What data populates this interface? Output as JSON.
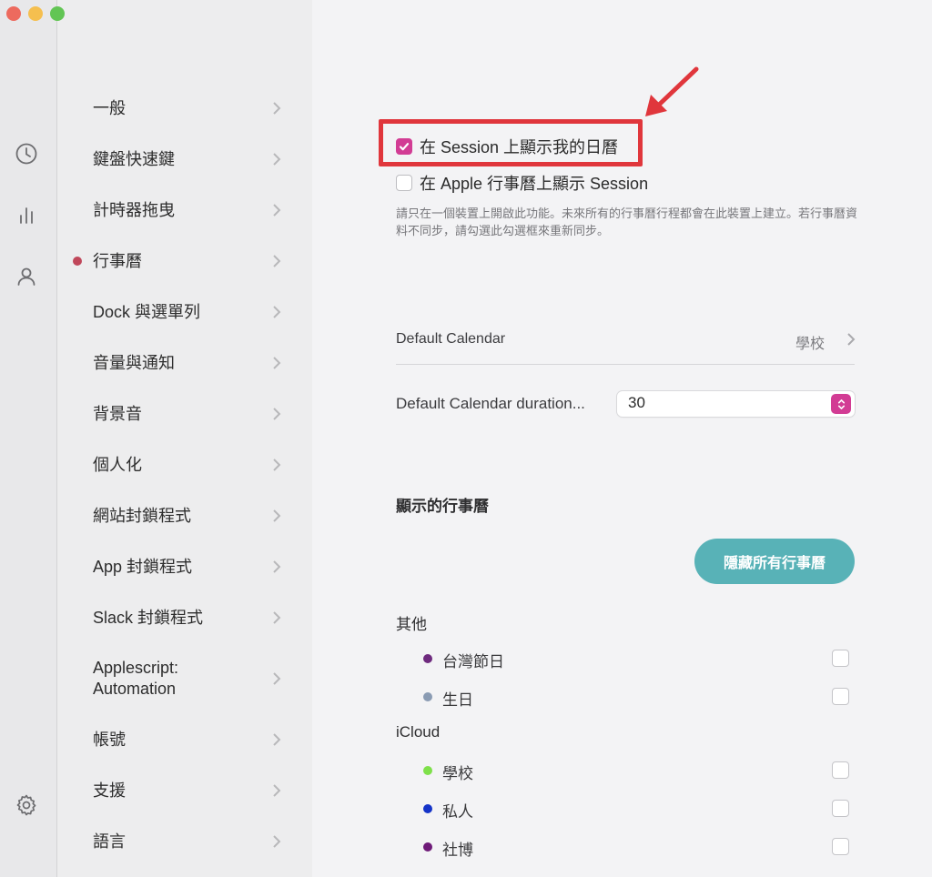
{
  "sidebar": {
    "items": [
      {
        "label": "一般",
        "active": false
      },
      {
        "label": "鍵盤快速鍵",
        "active": false
      },
      {
        "label": "計時器拖曳",
        "active": false
      },
      {
        "label": "行事曆",
        "active": true
      },
      {
        "label": "Dock 與選單列",
        "active": false
      },
      {
        "label": "音量與通知",
        "active": false
      },
      {
        "label": "背景音",
        "active": false
      },
      {
        "label": "個人化",
        "active": false
      },
      {
        "label": "網站封鎖程式",
        "active": false
      },
      {
        "label": "App 封鎖程式",
        "active": false
      },
      {
        "label": "Slack 封鎖程式",
        "active": false
      },
      {
        "label": "Applescript:\nAutomation",
        "active": false
      },
      {
        "label": "帳號",
        "active": false
      },
      {
        "label": "支援",
        "active": false
      },
      {
        "label": "語言",
        "active": false
      }
    ]
  },
  "rail_icons": [
    "clock-icon",
    "bar-chart-icon",
    "person-icon",
    "gear-icon"
  ],
  "main": {
    "show_calendar_in_session": {
      "label": "在 Session 上顯示我的日曆",
      "checked": true
    },
    "show_session_in_apple_calendar": {
      "label": "在 Apple 行事曆上顯示 Session",
      "checked": false
    },
    "help_text": "請只在一個裝置上開啟此功能。未來所有的行事曆行程都會在此裝置上建立。若行事曆資料不同步，請勾選此勾選框來重新同步。",
    "default_calendar": {
      "label": "Default Calendar",
      "value": "學校"
    },
    "default_duration": {
      "label": "Default Calendar duration...",
      "value": "30"
    },
    "shown_calendars_title": "顯示的行事曆",
    "hide_all_button": "隱藏所有行事曆",
    "groups": [
      {
        "name": "其他",
        "calendars": [
          {
            "name": "台灣節日",
            "color": "#6e2a7e",
            "checked": false
          },
          {
            "name": "生日",
            "color": "#8a9bb3",
            "checked": false
          }
        ]
      },
      {
        "name": "iCloud",
        "calendars": [
          {
            "name": "學校",
            "color": "#7ee04a",
            "checked": false
          },
          {
            "name": "私人",
            "color": "#1433c8",
            "checked": false
          },
          {
            "name": "社博",
            "color": "#6e1a78",
            "checked": false
          }
        ]
      }
    ]
  },
  "colors": {
    "accent": "#d23c94",
    "button": "#58b2b7",
    "highlight": "#e0363c",
    "active_bullet": "#c0475a"
  }
}
